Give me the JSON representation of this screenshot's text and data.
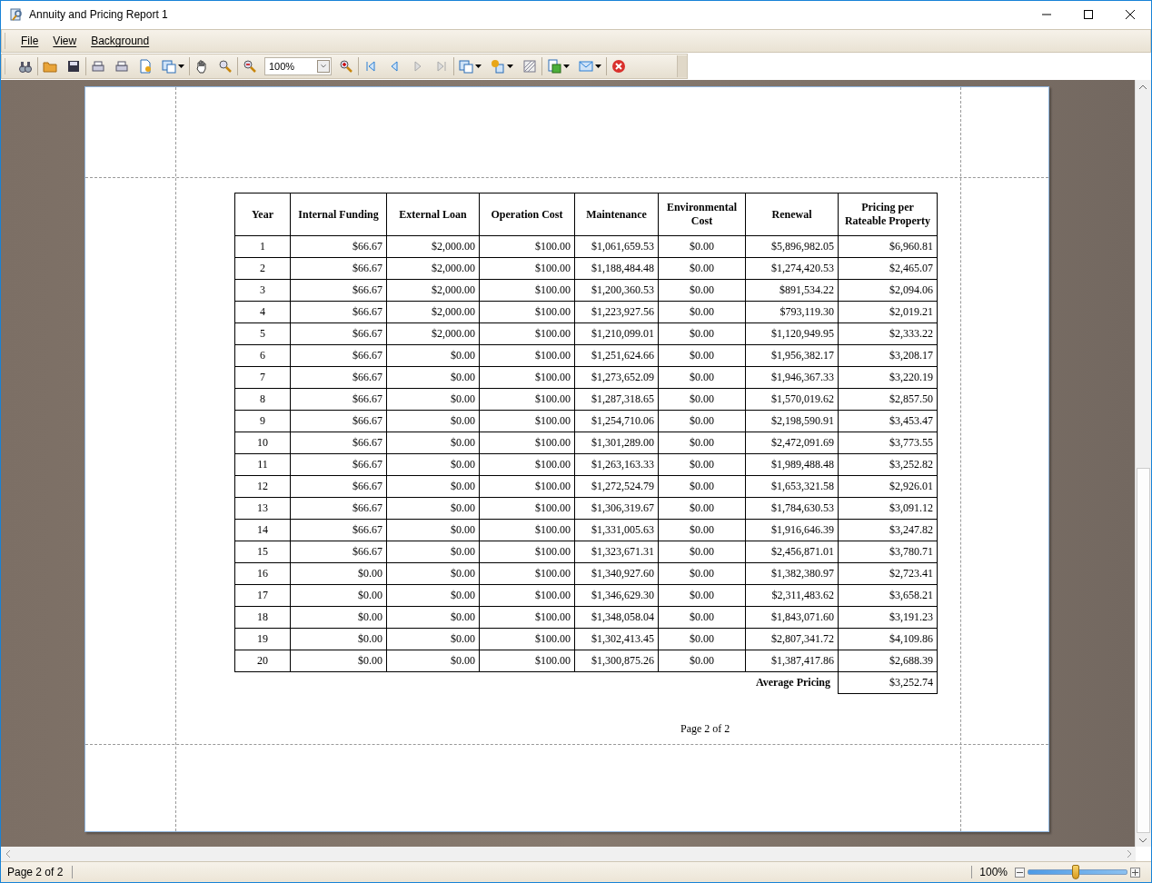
{
  "window": {
    "title": "Annuity and Pricing Report 1"
  },
  "menu": [
    "File",
    "View",
    "Background"
  ],
  "toolbar": {
    "zoom_value": "100%"
  },
  "table": {
    "columns": [
      "Year",
      "Internal Funding",
      "External Loan",
      "Operation Cost",
      "Maintenance",
      "Environmental Cost",
      "Renewal",
      "Pricing per Rateable Property"
    ],
    "rows": [
      [
        "1",
        "$66.67",
        "$2,000.00",
        "$100.00",
        "$1,061,659.53",
        "$0.00",
        "$5,896,982.05",
        "$6,960.81"
      ],
      [
        "2",
        "$66.67",
        "$2,000.00",
        "$100.00",
        "$1,188,484.48",
        "$0.00",
        "$1,274,420.53",
        "$2,465.07"
      ],
      [
        "3",
        "$66.67",
        "$2,000.00",
        "$100.00",
        "$1,200,360.53",
        "$0.00",
        "$891,534.22",
        "$2,094.06"
      ],
      [
        "4",
        "$66.67",
        "$2,000.00",
        "$100.00",
        "$1,223,927.56",
        "$0.00",
        "$793,119.30",
        "$2,019.21"
      ],
      [
        "5",
        "$66.67",
        "$2,000.00",
        "$100.00",
        "$1,210,099.01",
        "$0.00",
        "$1,120,949.95",
        "$2,333.22"
      ],
      [
        "6",
        "$66.67",
        "$0.00",
        "$100.00",
        "$1,251,624.66",
        "$0.00",
        "$1,956,382.17",
        "$3,208.17"
      ],
      [
        "7",
        "$66.67",
        "$0.00",
        "$100.00",
        "$1,273,652.09",
        "$0.00",
        "$1,946,367.33",
        "$3,220.19"
      ],
      [
        "8",
        "$66.67",
        "$0.00",
        "$100.00",
        "$1,287,318.65",
        "$0.00",
        "$1,570,019.62",
        "$2,857.50"
      ],
      [
        "9",
        "$66.67",
        "$0.00",
        "$100.00",
        "$1,254,710.06",
        "$0.00",
        "$2,198,590.91",
        "$3,453.47"
      ],
      [
        "10",
        "$66.67",
        "$0.00",
        "$100.00",
        "$1,301,289.00",
        "$0.00",
        "$2,472,091.69",
        "$3,773.55"
      ],
      [
        "11",
        "$66.67",
        "$0.00",
        "$100.00",
        "$1,263,163.33",
        "$0.00",
        "$1,989,488.48",
        "$3,252.82"
      ],
      [
        "12",
        "$66.67",
        "$0.00",
        "$100.00",
        "$1,272,524.79",
        "$0.00",
        "$1,653,321.58",
        "$2,926.01"
      ],
      [
        "13",
        "$66.67",
        "$0.00",
        "$100.00",
        "$1,306,319.67",
        "$0.00",
        "$1,784,630.53",
        "$3,091.12"
      ],
      [
        "14",
        "$66.67",
        "$0.00",
        "$100.00",
        "$1,331,005.63",
        "$0.00",
        "$1,916,646.39",
        "$3,247.82"
      ],
      [
        "15",
        "$66.67",
        "$0.00",
        "$100.00",
        "$1,323,671.31",
        "$0.00",
        "$2,456,871.01",
        "$3,780.71"
      ],
      [
        "16",
        "$0.00",
        "$0.00",
        "$100.00",
        "$1,340,927.60",
        "$0.00",
        "$1,382,380.97",
        "$2,723.41"
      ],
      [
        "17",
        "$0.00",
        "$0.00",
        "$100.00",
        "$1,346,629.30",
        "$0.00",
        "$2,311,483.62",
        "$3,658.21"
      ],
      [
        "18",
        "$0.00",
        "$0.00",
        "$100.00",
        "$1,348,058.04",
        "$0.00",
        "$1,843,071.60",
        "$3,191.23"
      ],
      [
        "19",
        "$0.00",
        "$0.00",
        "$100.00",
        "$1,302,413.45",
        "$0.00",
        "$2,807,341.72",
        "$4,109.86"
      ],
      [
        "20",
        "$0.00",
        "$0.00",
        "$100.00",
        "$1,300,875.26",
        "$0.00",
        "$1,387,417.86",
        "$2,688.39"
      ]
    ],
    "summary": {
      "label": "Average Pricing",
      "value": "$3,252.74"
    }
  },
  "page_footer": "Page 2 of 2",
  "status_bar": {
    "page": "Page 2 of 2",
    "zoom": "100%",
    "zoom_slider": {
      "level": 0.48
    }
  }
}
